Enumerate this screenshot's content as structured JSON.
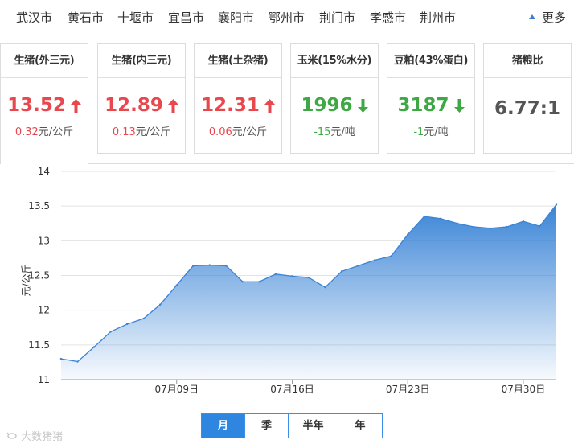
{
  "city_tabs": [
    "武汉市",
    "黄石市",
    "十堰市",
    "宜昌市",
    "襄阳市",
    "鄂州市",
    "荆门市",
    "孝感市",
    "荆州市"
  ],
  "more_label": "更多",
  "cards": [
    {
      "title": "生猪(外三元)",
      "value": "13.52",
      "trend": "up",
      "change": "0.32",
      "unit": "元/公斤"
    },
    {
      "title": "生猪(内三元)",
      "value": "12.89",
      "trend": "up",
      "change": "0.13",
      "unit": "元/公斤"
    },
    {
      "title": "生猪(土杂猪)",
      "value": "12.31",
      "trend": "up",
      "change": "0.06",
      "unit": "元/公斤"
    },
    {
      "title": "玉米(15%水分)",
      "value": "1996",
      "trend": "down",
      "change": "-15",
      "unit": "元/吨"
    },
    {
      "title": "豆粕(43%蛋白)",
      "value": "3187",
      "trend": "down",
      "change": "-1",
      "unit": "元/吨"
    },
    {
      "title": "猪粮比",
      "value": "6.77:1",
      "trend": "none",
      "change": "",
      "unit": ""
    }
  ],
  "chart_data": {
    "type": "area",
    "ylabel": "元/公斤",
    "ylim": [
      11,
      14
    ],
    "yticks": [
      "11",
      "11.5",
      "12",
      "12.5",
      "13",
      "13.5",
      "14"
    ],
    "xtick_labels": [
      "07月09日",
      "07月16日",
      "07月23日",
      "07月30日"
    ],
    "grid": true,
    "series": [
      {
        "values": [
          11.3,
          11.26,
          11.47,
          11.69,
          11.8,
          11.88,
          12.08,
          12.36,
          12.64,
          12.65,
          12.64,
          12.41,
          12.41,
          12.52,
          12.49,
          12.47,
          12.33,
          12.56,
          12.64,
          12.72,
          12.78,
          13.09,
          13.35,
          13.32,
          13.25,
          13.2,
          13.18,
          13.2,
          13.28,
          13.21,
          13.52
        ]
      }
    ],
    "color": "#3a84d6"
  },
  "range_tabs": [
    "月",
    "季",
    "半年",
    "年"
  ],
  "active_range": "月",
  "watermark": "大数猪猪"
}
